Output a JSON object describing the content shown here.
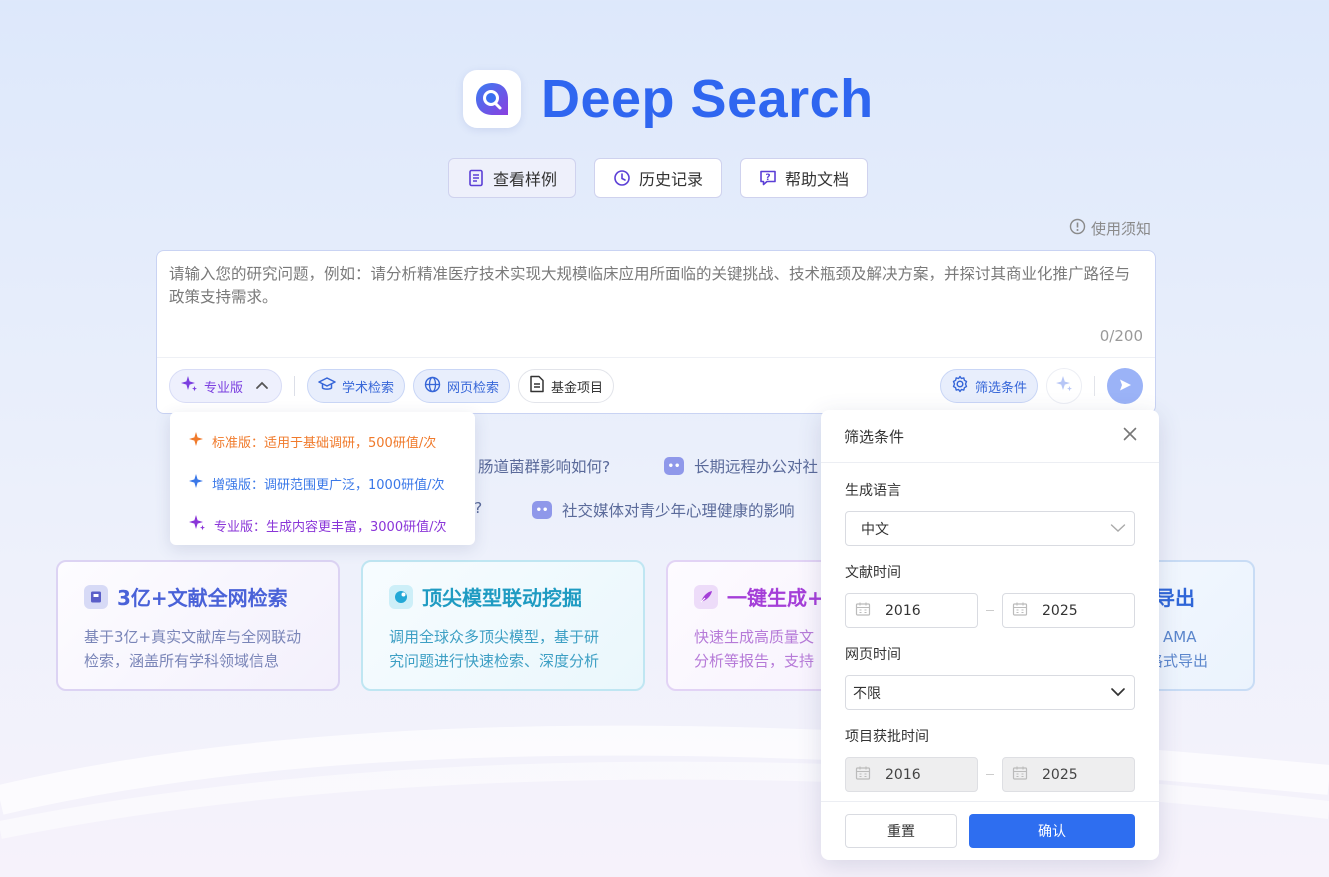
{
  "brand": {
    "title": "Deep Search"
  },
  "top_buttons": [
    {
      "label": "查看样例"
    },
    {
      "label": "历史记录"
    },
    {
      "label": "帮助文档"
    }
  ],
  "notice": {
    "label": "使用须知"
  },
  "input": {
    "placeholder": "请输入您的研究问题，例如：请分析精准医疗技术实现大规模临床应用所面临的关键挑战、技术瓶颈及解决方案，并探讨其商业化推广路径与政策支持需求。",
    "counter": "0/200"
  },
  "toolbar": {
    "version": "专业版",
    "academic": "学术检索",
    "web": "网页检索",
    "fund": "基金项目",
    "filter": "筛选条件"
  },
  "version_menu": [
    {
      "label": "标准版：适用于基础调研，500研值/次",
      "color": "#f07a2b"
    },
    {
      "label": "增强版：调研范围更广泛，1000研值/次",
      "color": "#3a78e8"
    },
    {
      "label": "专业版：生成内容更丰富，3000研值/次",
      "color": "#8a35d8"
    }
  ],
  "suggestions": {
    "row1_a": "肠道菌群影响如何?",
    "row1_b": "长期远程办公对社",
    "row2_a": "?",
    "row2_b": "社交媒体对青少年心理健康的影响"
  },
  "features": [
    {
      "title": "3亿+文献全网检索",
      "desc1": "基于3亿+真实文献库与全网联动",
      "desc2": "检索，涵盖所有学科领域信息"
    },
    {
      "title": "顶尖模型联动挖掘",
      "desc1": "调用全球众多顶尖模型，基于研",
      "desc2": "究问题进行快速检索、深度分析"
    },
    {
      "title": "一键生成+",
      "desc1": "快速生成高质量文",
      "desc2": "分析等报告，支持"
    },
    {
      "title": "导出",
      "desc1": "、AMA",
      "desc2": "格式导出"
    }
  ],
  "filter_panel": {
    "title": "筛选条件",
    "lang_label": "生成语言",
    "lang_value": "中文",
    "lit_label": "文献时间",
    "lit_from": "2016",
    "lit_to": "2025",
    "web_label": "网页时间",
    "web_value": "不限",
    "proj_label": "项目获批时间",
    "proj_from": "2016",
    "proj_to": "2025",
    "reset": "重置",
    "confirm": "确认"
  },
  "colors": {
    "accent": "#2f66f0",
    "primary_button": "#2e6ef0"
  }
}
